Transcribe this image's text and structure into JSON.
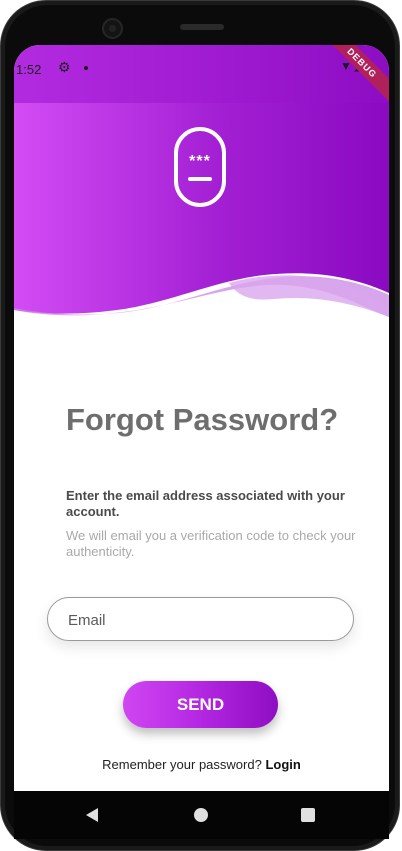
{
  "status_bar": {
    "time": "1:52",
    "icons": [
      "gear-icon",
      "dot-icon",
      "wifi-icon",
      "signal-icon"
    ],
    "debug_banner": "DEBUG"
  },
  "header": {
    "icon": "password-field-icon",
    "icon_text": "***",
    "gradient_colors": [
      "#d34cf5",
      "#a21fd3",
      "#8a0ac2"
    ]
  },
  "content": {
    "title": "Forgot Password?",
    "subtitle": "Enter the email address associated with your account.",
    "info": "We will email you a verification code to check your authenticity.",
    "email_placeholder": "Email",
    "email_value": "",
    "send_label": "SEND",
    "remember_text": "Remember your password?",
    "login_label": "Login"
  },
  "colors": {
    "accent": "#b72ae4",
    "accent_dark": "#8e0dc2",
    "title": "#6e6e6e"
  },
  "nav_bar": {
    "buttons": [
      "back-icon",
      "home-icon",
      "recents-icon"
    ]
  }
}
